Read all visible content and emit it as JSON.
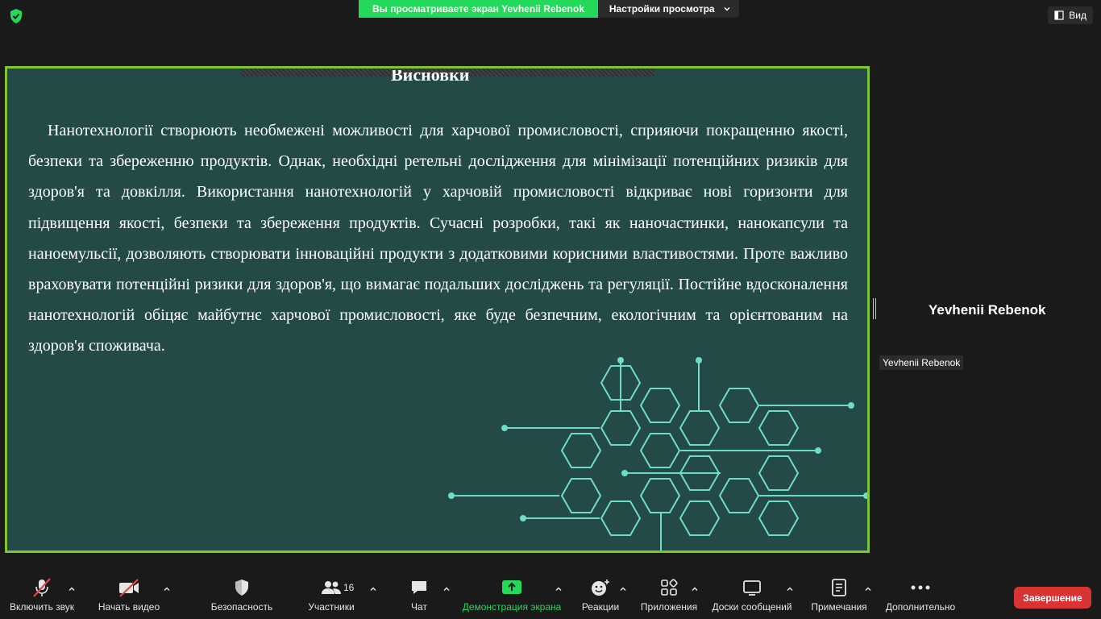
{
  "top_bar": {
    "sharing_banner": "Вы просматриваете экран Yevhenii Rebenok",
    "view_options": "Настройки просмотра",
    "view_button": "Вид"
  },
  "slide": {
    "title": "Висновки",
    "body": "Нанотехнології створюють необмежені можливості для харчової промисловості, сприяючи покращенню якості, безпеки та збереженню продуктів. Однак, необхідні ретельні дослідження для мінімізації потенційних ризиків для здоров'я та довкілля. Використання нанотехнологій у харчовій промисловості відкриває нові горизонти для підвищення якості, безпеки та збереження продуктів. Сучасні розробки, такі як наночастинки, нанокапсули та наноемульсії, дозволяють створювати інноваційні продукти з додатковими корисними властивостями. Проте важливо враховувати потенційні ризики для здоров'я, що вимагає подальших досліджень та регуляції. Постійне вдосконалення нанотехнологій обіцяє майбутнє харчової промисловості, яке буде безпечним, екологічним та орієнтованим на здоров'я споживача."
  },
  "participant": {
    "name": "Yevhenii Rebenok",
    "name_tag": "Yevhenii Rebenok"
  },
  "toolbar": {
    "audio": "Включить звук",
    "video": "Начать видео",
    "security": "Безопасность",
    "participants": "Участники",
    "participants_count": "16",
    "chat": "Чат",
    "share": "Демонстрация экрана",
    "reactions": "Реакции",
    "apps": "Приложения",
    "whiteboards": "Доски сообщений",
    "notes": "Примечания",
    "more": "Дополнительно",
    "end": "Завершение"
  },
  "colors": {
    "share_green": "#23d959",
    "slide_bg": "#234a47",
    "slide_border": "#7fc433",
    "hex_stroke": "#6fdcc8",
    "end_red": "#d93434",
    "muted_red": "#e0454b"
  }
}
